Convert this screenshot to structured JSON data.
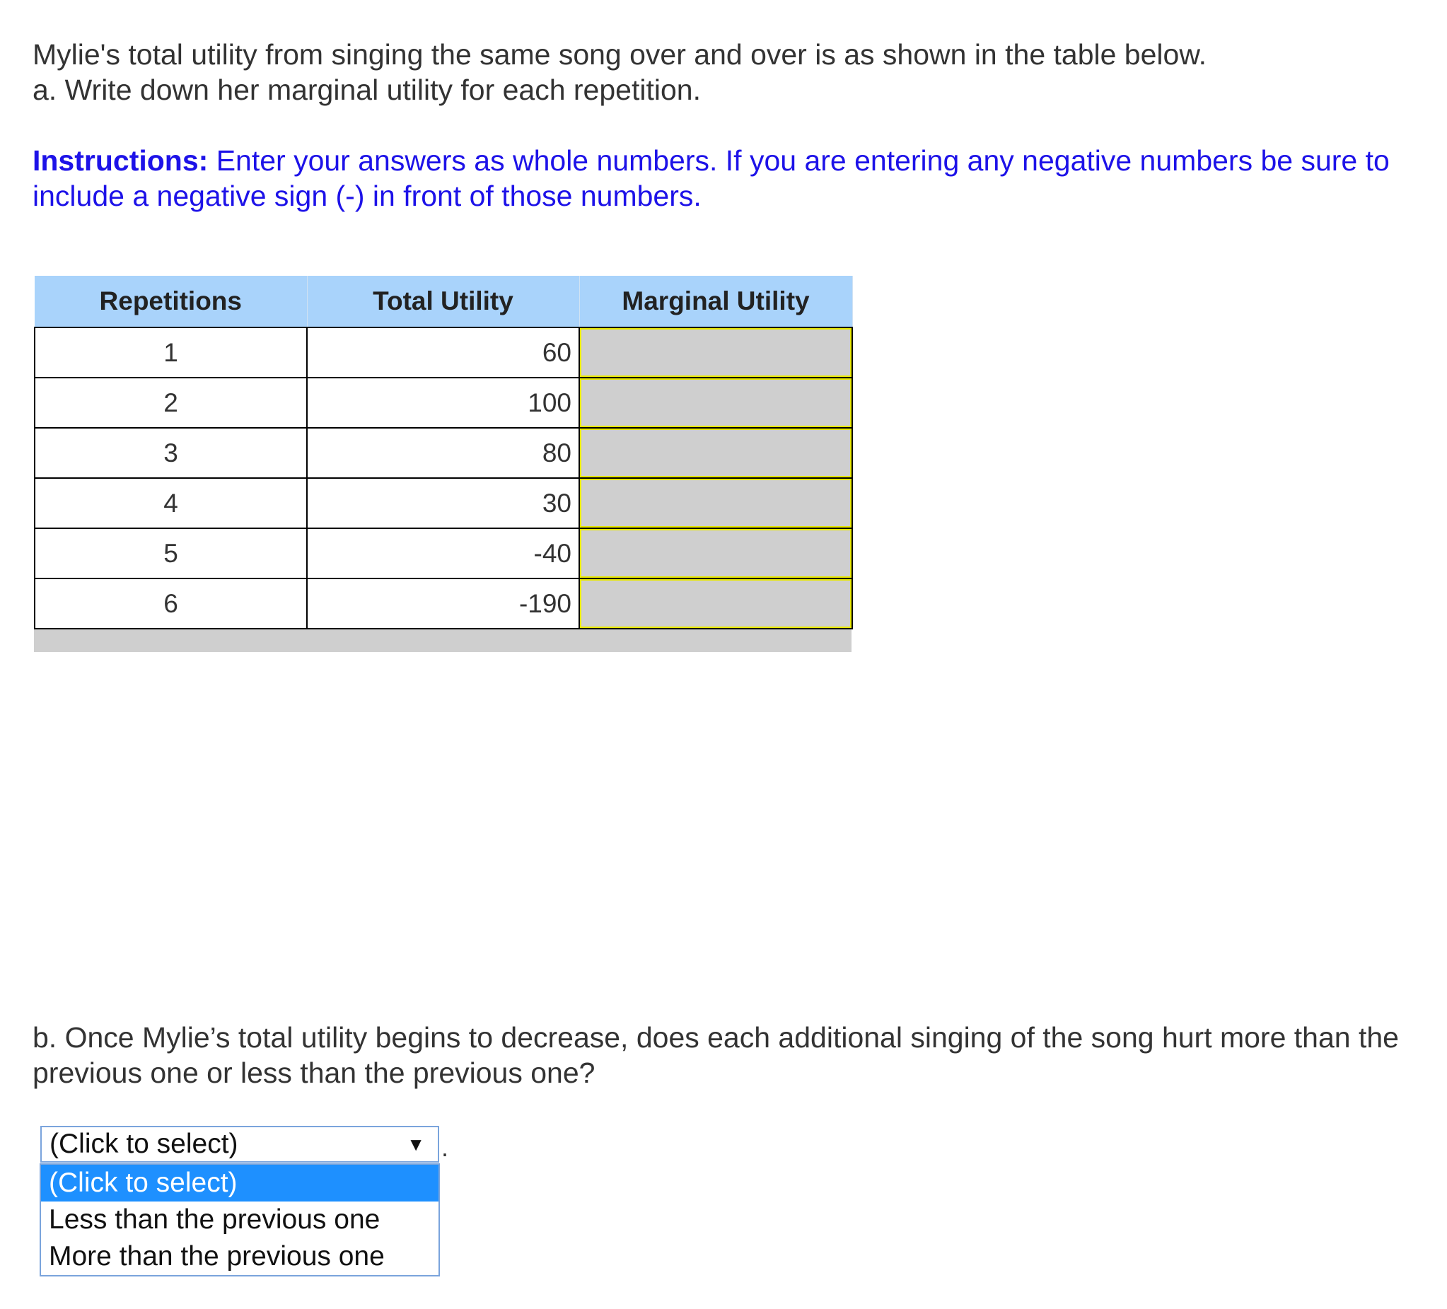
{
  "question": {
    "intro_line1": "Mylie's total utility from singing the same song over and over is as shown in the table below.",
    "intro_line2": "a. Write down her marginal utility for each repetition.",
    "instructions_label": "Instructions:",
    "instructions_text": " Enter your answers as whole numbers. If you are entering any negative numbers be sure to include a negative sign (-) in front of those numbers.",
    "part_b": "b. Once Mylie’s total utility begins to decrease, does each additional singing of the song hurt more than the previous one or less than the previous one?"
  },
  "table": {
    "headers": [
      "Repetitions",
      "Total Utility",
      "Marginal Utility"
    ],
    "rows": [
      {
        "repetitions": "1",
        "total_utility": "60",
        "marginal_utility": ""
      },
      {
        "repetitions": "2",
        "total_utility": "100",
        "marginal_utility": ""
      },
      {
        "repetitions": "3",
        "total_utility": "80",
        "marginal_utility": ""
      },
      {
        "repetitions": "4",
        "total_utility": "30",
        "marginal_utility": ""
      },
      {
        "repetitions": "5",
        "total_utility": "-40",
        "marginal_utility": ""
      },
      {
        "repetitions": "6",
        "total_utility": "-190",
        "marginal_utility": ""
      }
    ]
  },
  "dropdown": {
    "selected": "(Click to select)",
    "arrow_icon": "caret-down-icon",
    "trailing_text": ".",
    "options": [
      "(Click to select)",
      "Less than the previous one",
      "More than the previous one"
    ],
    "highlighted_index": 0
  },
  "colors": {
    "instructions": "#1d12e8",
    "header_bg": "#a9d3fb",
    "input_bg": "#cfcfcf",
    "input_border": "#e8e800",
    "option_highlight": "#1e90ff"
  }
}
